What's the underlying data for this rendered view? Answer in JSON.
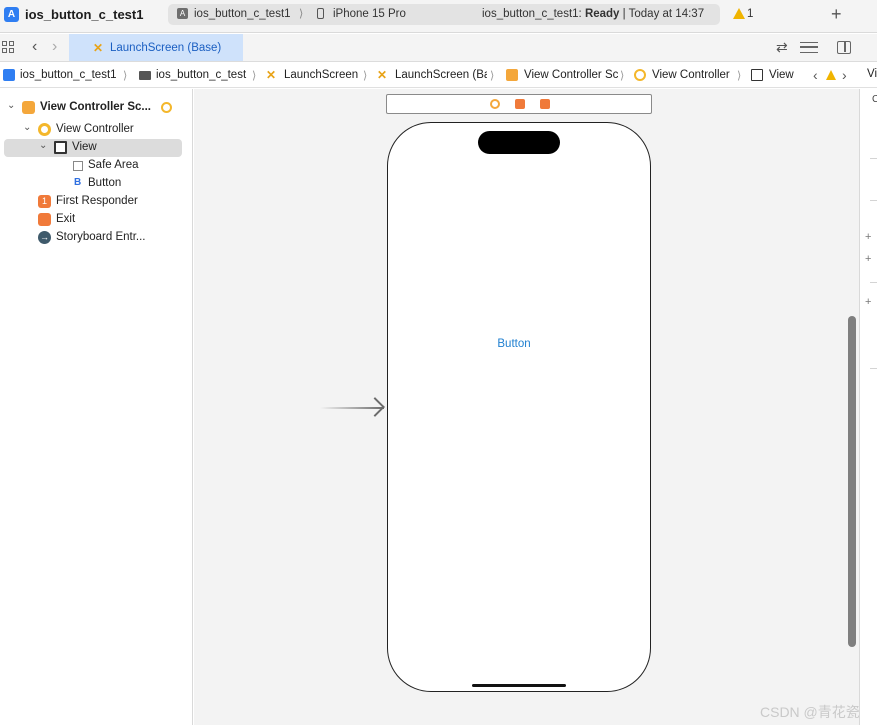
{
  "titlebar": {
    "project_name": "ios_button_c_test1",
    "scheme": "ios_button_c_test1",
    "device": "iPhone 15 Pro",
    "status_prefix": "ios_button_c_test1: ",
    "status_state": "Ready",
    "status_time": " | Today at 14:37",
    "warning_count": "1"
  },
  "tab": {
    "label": "LaunchScreen (Base)"
  },
  "jumpbar": {
    "items": [
      "ios_button_c_test1",
      "ios_button_c_test",
      "LaunchScreen",
      "LaunchScreen (Ba",
      "View Controller Sc",
      "View Controller",
      "View"
    ]
  },
  "outline": {
    "scene": "View Controller Sc...",
    "view_controller": "View Controller",
    "view": "View",
    "safe_area": "Safe Area",
    "button": "Button",
    "first_responder": "First Responder",
    "exit": "Exit",
    "storyboard_entry": "Storyboard Entr..."
  },
  "canvas": {
    "button_title": "Button"
  },
  "inspector": {
    "label": "Vi"
  },
  "watermark": "CSDN @青花瓷",
  "colors": {
    "accent": "#1e7fd0",
    "tab_highlight": "#cfe2fb",
    "warning": "#f0b400",
    "view_controller": "#f4b72b",
    "first_responder": "#f07a3a"
  }
}
